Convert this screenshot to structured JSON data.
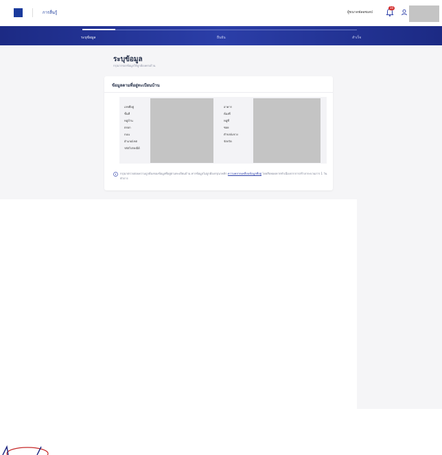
{
  "header": {
    "brand": "การลื่นรู้",
    "user_name": "ผู้ขนาดฟลอซเดป",
    "notification_count": "10"
  },
  "stepper": {
    "steps": [
      {
        "label": "ระบุข้อมูล",
        "active": true
      },
      {
        "label": "ยืนยัน",
        "active": false
      },
      {
        "label": "สำเร็จ",
        "active": false
      }
    ]
  },
  "page": {
    "title": "ระบุข้อมูล",
    "subtitle": "กรุณากรอกข้อมูลให้ถูกต้องครบถ้วน"
  },
  "card": {
    "title": "ข้อมูลตามที่อยู่ทะเบียนบ้าน",
    "left_labels": [
      "เลขที่อยู่",
      "ชั้นที่",
      "หมู่บ้าน",
      "ตรอก",
      "ถนน",
      "อำเภอ/เขต",
      "รหัสไปรษณีย์"
    ],
    "right_labels": [
      "อาคาร",
      "ห้องที่",
      "หมู่ที่",
      "ซอย",
      "ตำบล/แขวง",
      "จังหวัด"
    ],
    "info_text": "กรุณาตรวจสอบความถูกต้องของข้อมูลที่อยู่ตามทะเบียนบ้าน หากข้อมูลไม่ถูกต้องกรุณาคลิก",
    "info_link": "ความคลาดเคลื่อนข้อมูลที่อยู่",
    "info_tail": "โดยสืบทอดหากทำเนื่องจากการสร้างกระบวนการ 1 วันทำการ"
  },
  "colors": {
    "brand": "#1a3a9c",
    "stepper_bg": "#243599",
    "badge": "#d32f2f"
  }
}
